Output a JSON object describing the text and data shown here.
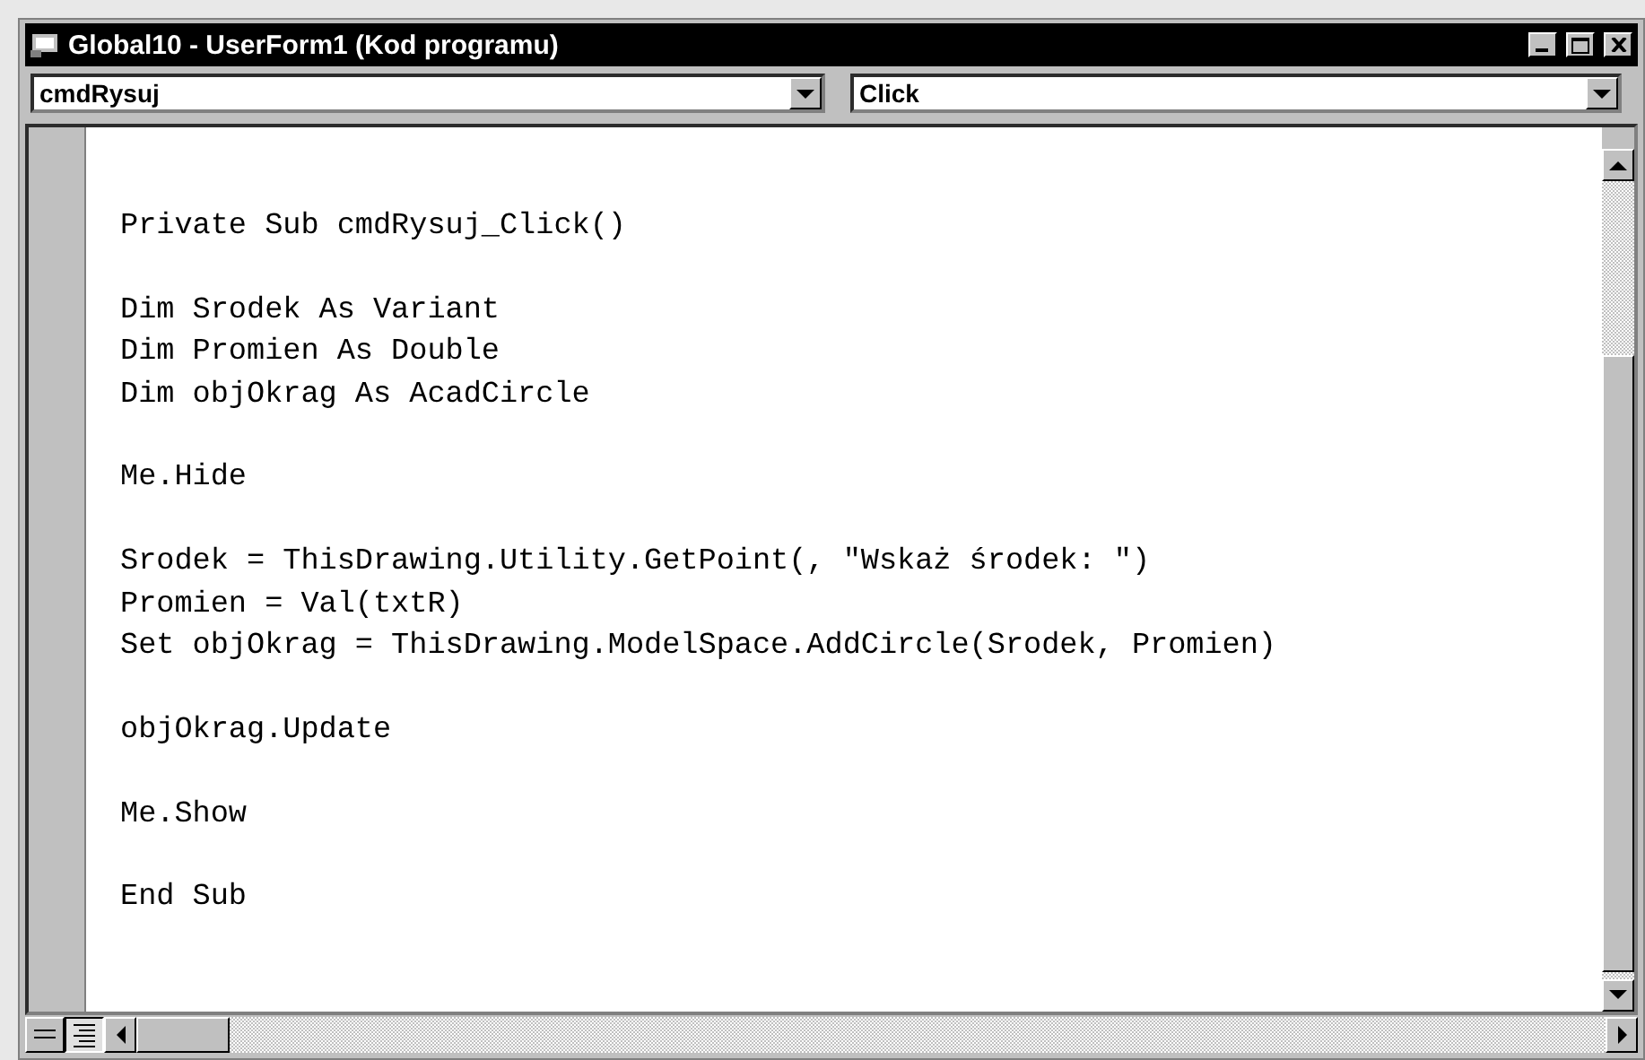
{
  "window": {
    "title": "Global10 - UserForm1 (Kod programu)"
  },
  "object_dropdown": {
    "value": "cmdRysuj"
  },
  "procedure_dropdown": {
    "value": "Click"
  },
  "code_blocks": [
    [
      "Private Sub cmdRysuj_Click()"
    ],
    [
      "Dim Srodek As Variant",
      "Dim Promien As Double",
      "Dim objOkrag As AcadCircle"
    ],
    [
      "Me.Hide"
    ],
    [
      "Srodek = ThisDrawing.Utility.GetPoint(, \"Wskaż środek: \")",
      "Promien = Val(txtR)",
      "Set objOkrag = ThisDrawing.ModelSpace.AddCircle(Srodek, Promien)"
    ],
    [
      "objOkrag.Update"
    ],
    [
      "Me.Show"
    ],
    [
      "End Sub"
    ]
  ],
  "view_buttons": [
    {
      "kind": "procedure",
      "selected": false
    },
    {
      "kind": "module",
      "selected": true
    }
  ]
}
